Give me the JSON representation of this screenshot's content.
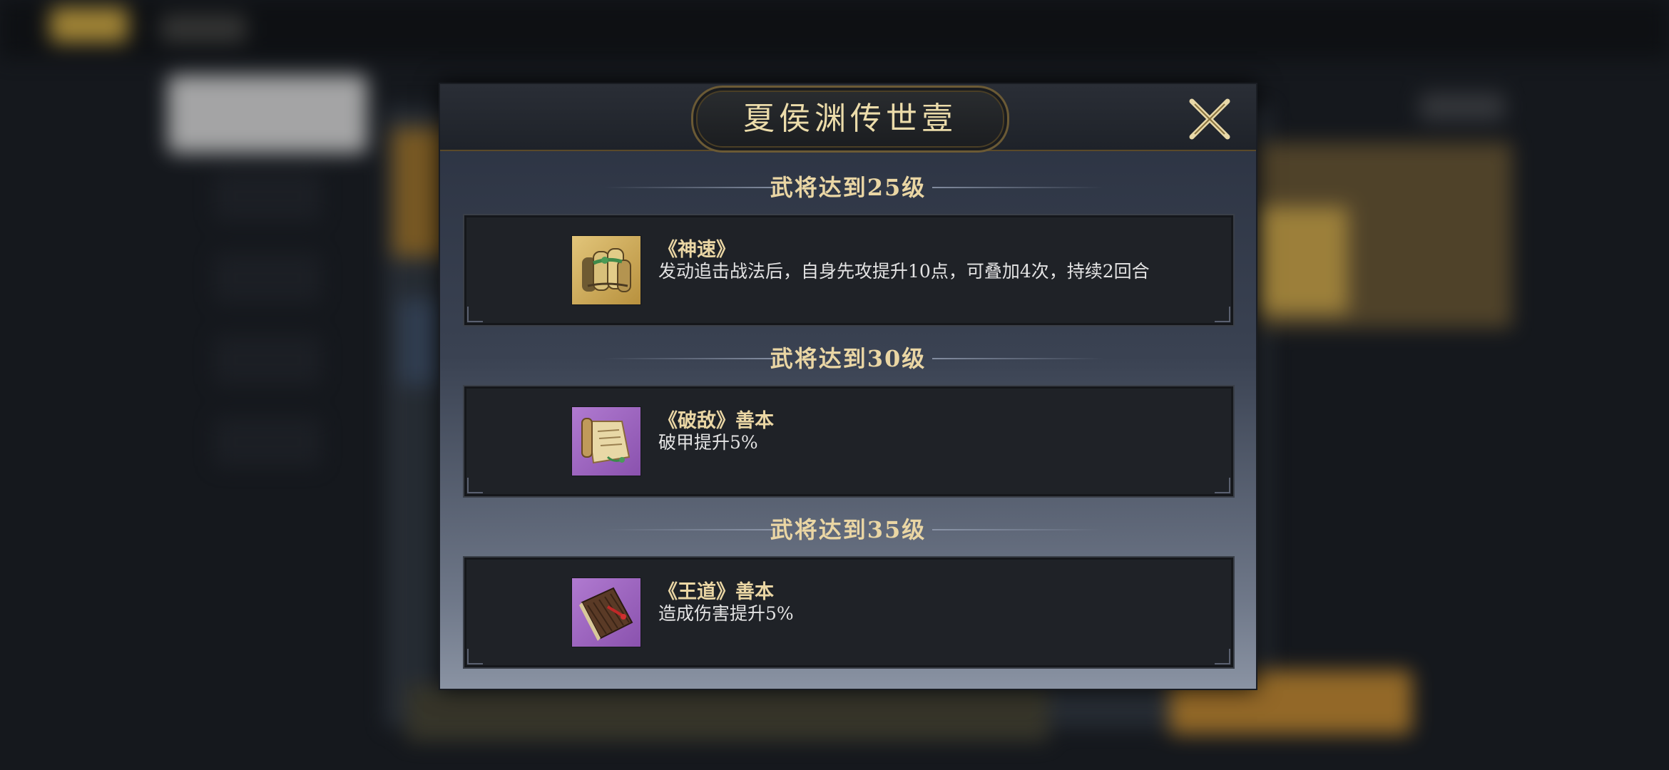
{
  "modal": {
    "title": "夏侯渊传世壹",
    "close_icon": "close-icon"
  },
  "rewards": [
    {
      "requirement": "武将达到25级",
      "item_name": "《神速》",
      "description": "发动追击战法后，自身先攻提升10点，可叠加4次，持续2回合",
      "icon": "scroll-bundle-icon",
      "rarity_color": "#c9a24a"
    },
    {
      "requirement": "武将达到30级",
      "item_name": "《破敌》善本",
      "description": "破甲提升5%",
      "icon": "open-scroll-icon",
      "rarity_color": "#a066c0"
    },
    {
      "requirement": "武将达到35级",
      "item_name": "《王道》善本",
      "description": "造成伤害提升5%",
      "icon": "bamboo-book-icon",
      "rarity_color": "#a066c0"
    }
  ]
}
